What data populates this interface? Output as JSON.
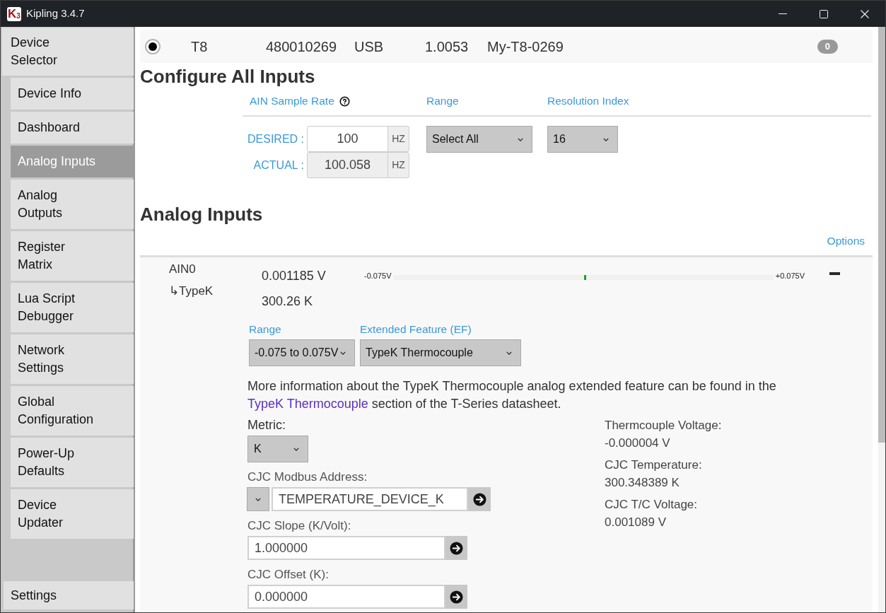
{
  "window": {
    "logo": "K$_{3}$",
    "title": "Kipling 3.4.7"
  },
  "sidebar": {
    "items": [
      {
        "label": "Device Selector",
        "selected": false,
        "children": [
          {
            "label": "Device Info",
            "selected": false
          },
          {
            "label": "Dashboard",
            "selected": false
          },
          {
            "label": "Analog Inputs",
            "selected": true
          },
          {
            "label": "Analog Outputs",
            "selected": false
          },
          {
            "label": "Register Matrix",
            "selected": false
          },
          {
            "label": "Lua Script Debugger",
            "selected": false
          },
          {
            "label": "Network Settings",
            "selected": false
          },
          {
            "label": "Global Configuration",
            "selected": false
          },
          {
            "label": "Power-Up Defaults",
            "selected": false
          },
          {
            "label": "Device Updater",
            "selected": false
          }
        ]
      }
    ],
    "footer_item": {
      "label": "Settings",
      "selected": false
    }
  },
  "devices": [
    {
      "selected": true,
      "cells": [
        "T8",
        "480010269",
        "USB",
        "1.0053",
        "My-T8-0269"
      ],
      "badge": "0"
    }
  ],
  "configure_all_inputs": {
    "title": "Configure All Inputs",
    "columns": [
      {
        "label": "AIN Sample Rate",
        "help": true
      },
      {
        "label": "Range",
        "help": false
      },
      {
        "label": "Resolution Index",
        "help": false
      }
    ],
    "sample_rate": [
      {
        "label": "DESIRED :",
        "value": "100",
        "unit": "HZ",
        "disabled": false
      },
      {
        "label": "ACTUAL :",
        "value": "100.058",
        "unit": "HZ",
        "disabled": true
      }
    ],
    "range": {
      "value": "Select All"
    },
    "resolution_index": {
      "value": "16"
    }
  },
  "analog_inputs": {
    "title": "Analog Inputs",
    "options_link": "Options",
    "channels": [
      {
        "name": "AIN0",
        "feature": "↳TypeK",
        "readings": [
          "0.001185 V",
          "300.26 K"
        ],
        "meter": {
          "min_label": "-0.075V",
          "max_label": "+0.075V",
          "level": 0.508
        },
        "expanded": true,
        "range": {
          "label": "Range",
          "value": "-0.075 to 0.075V"
        },
        "extended_feature": {
          "label": "Extended Feature (EF)",
          "value": "TypeK Thermocouple"
        },
        "info": {
          "before": "More information about the TypeK Thermocouple analog extended feature can be found in the",
          "link": "TypeK Thermocouple",
          "after": "section of the T-Series datasheet."
        },
        "settings": [
          {
            "kind": "select",
            "label": "Metric:",
            "value": "K"
          },
          {
            "kind": "address",
            "label": "CJC Modbus Address:",
            "value": "TEMPERATURE_DEVICE_K"
          },
          {
            "kind": "input",
            "label": "CJC Slope (K/Volt):",
            "value": "1.000000"
          },
          {
            "kind": "input",
            "label": "CJC Offset (K):",
            "value": "0.000000"
          }
        ],
        "readouts": [
          {
            "label": "Thermcouple Voltage:",
            "value": "-0.000004 V"
          },
          {
            "label": "CJC Temperature:",
            "value": "300.348389 K"
          },
          {
            "label": "CJC T/C Voltage:",
            "value": "0.001089 V"
          }
        ]
      }
    ]
  }
}
